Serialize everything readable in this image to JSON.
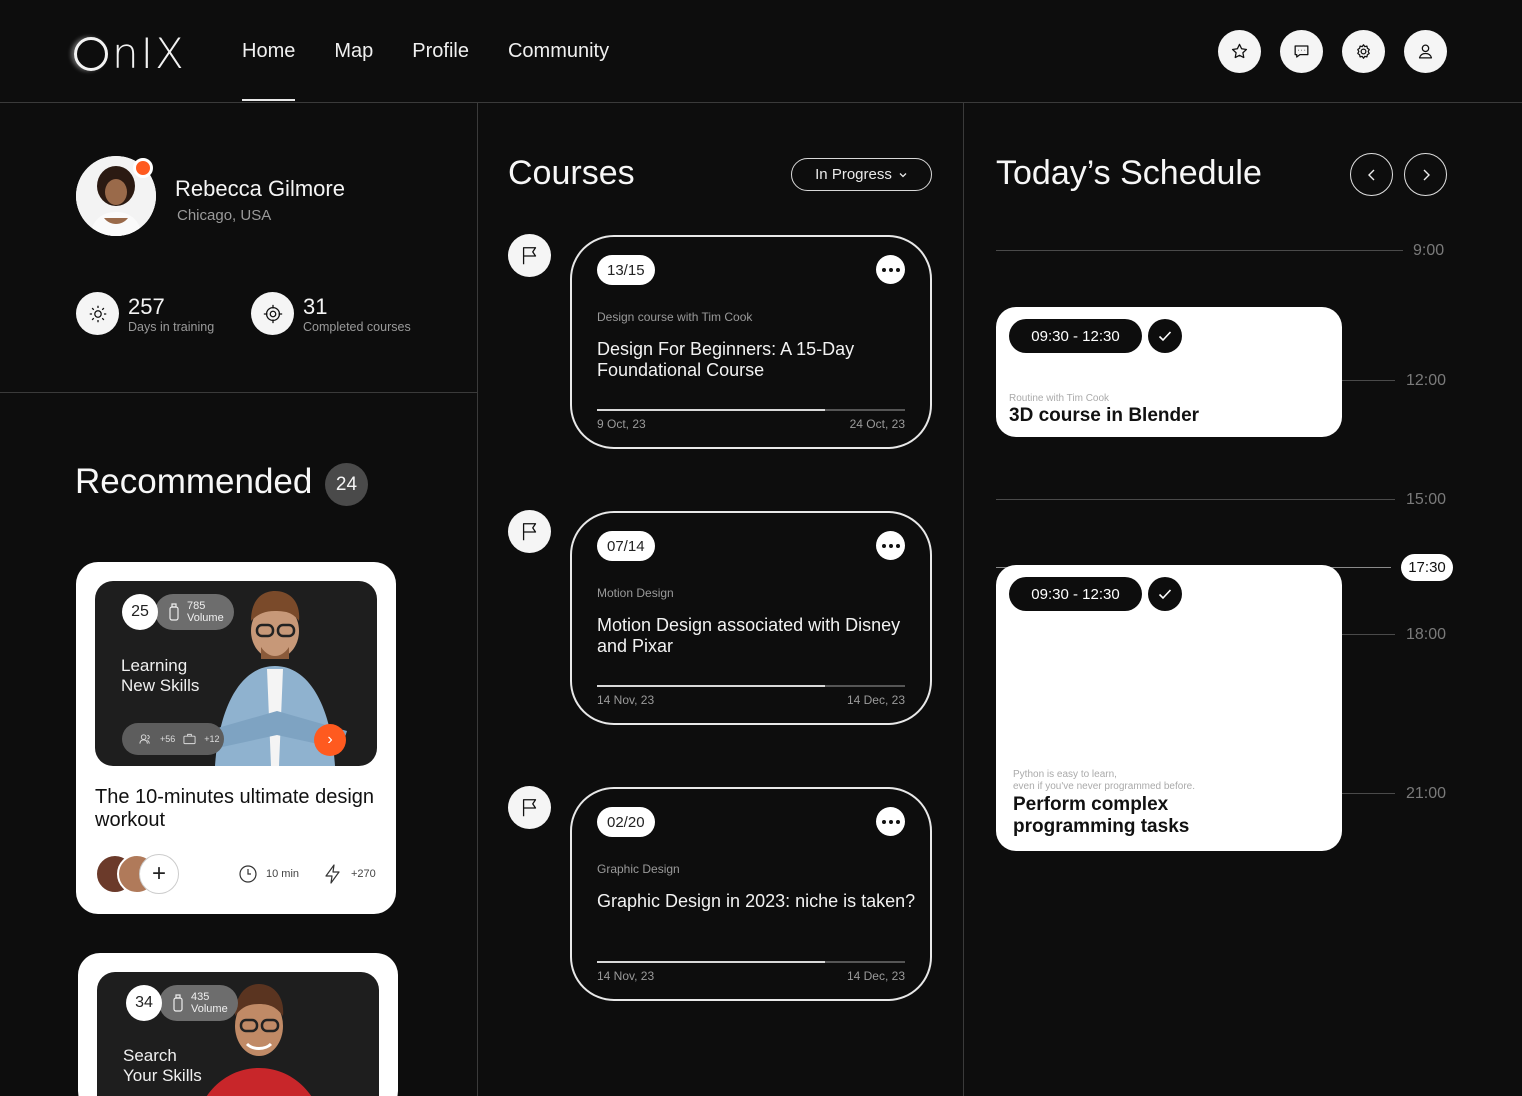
{
  "header": {
    "logo": "onix",
    "nav": [
      "Home",
      "Map",
      "Profile",
      "Community"
    ],
    "active_nav": "Home",
    "icons": [
      "star-icon",
      "chat-icon",
      "settings-icon",
      "user-icon"
    ]
  },
  "profile": {
    "name": "Rebecca Gilmore",
    "location": "Chicago, USA",
    "status_color": "#ff5a1f",
    "stats": [
      {
        "value": "257",
        "label": "Days in training",
        "icon": "sun-icon"
      },
      {
        "value": "31",
        "label": "Completed courses",
        "icon": "target-icon"
      }
    ]
  },
  "recommended": {
    "title": "Recommended",
    "count": "24",
    "cards": [
      {
        "number": "25",
        "volume_value": "785",
        "volume_label": "Volume",
        "caption_line1": "Learning",
        "caption_line2": "New Skills",
        "participants": "+56",
        "lessons": "+12",
        "title": "The 10-minutes ultimate design workout",
        "duration": "10 min",
        "points": "+270"
      },
      {
        "number": "34",
        "volume_value": "435",
        "volume_label": "Volume",
        "caption_line1": "Search",
        "caption_line2": "Your Skills"
      }
    ]
  },
  "courses": {
    "title": "Courses",
    "filter": "In Progress",
    "items": [
      {
        "badge": "13/15",
        "subtitle": "Design course with Tim Cook",
        "title": "Design For Beginners: A 15-Day Foundational Course",
        "start": "9 Oct, 23",
        "end": "24 Oct, 23",
        "progress": 0.74
      },
      {
        "badge": "07/14",
        "subtitle": "Motion Design",
        "title": "Motion Design associated with Disney and Pixar",
        "start": "14 Nov, 23",
        "end": "14 Dec, 23",
        "progress": 0.74
      },
      {
        "badge": "02/20",
        "subtitle": "Graphic Design",
        "title": "Graphic Design in 2023: niche is taken?",
        "start": "14 Nov, 23",
        "end": "14 Dec, 23",
        "progress": 0.74
      }
    ]
  },
  "schedule": {
    "title": "Today’s Schedule",
    "times": [
      "9:00",
      "12:00",
      "15:00",
      "18:00",
      "21:00"
    ],
    "now": "17:30",
    "events": [
      {
        "time": "09:30 - 12:30",
        "subtitle": "Routine with Tim Cook",
        "title": "3D course in Blender"
      },
      {
        "time": "09:30 - 12:30",
        "subtitle_line1": "Python is easy to learn,",
        "subtitle_line2": "even if you've never programmed before.",
        "title_line1": "Perform complex",
        "title_line2": "programming tasks"
      }
    ]
  }
}
